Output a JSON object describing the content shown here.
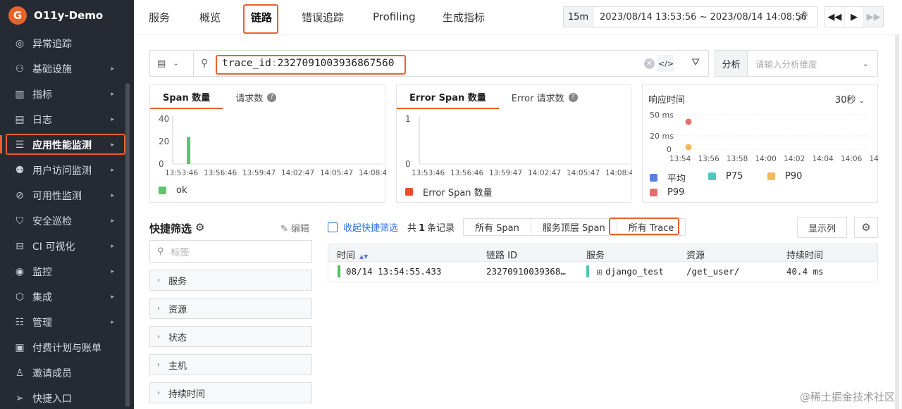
{
  "app": {
    "name": "O11y-Demo",
    "logo_letter": "G",
    "brand_color": "#e8622b"
  },
  "sidebar": {
    "items": [
      {
        "label": "异常追踪",
        "icon": "target-icon",
        "glyph": "◎",
        "arrow": false
      },
      {
        "label": "基础设施",
        "icon": "infrastructure-icon",
        "glyph": "⚇",
        "arrow": true
      },
      {
        "label": "指标",
        "icon": "metrics-icon",
        "glyph": "▥",
        "arrow": true
      },
      {
        "label": "日志",
        "icon": "log-icon",
        "glyph": "▤",
        "arrow": true
      },
      {
        "label": "应用性能监测",
        "icon": "apm-icon",
        "glyph": "☰",
        "arrow": true,
        "active": true
      },
      {
        "label": "用户访问监测",
        "icon": "rum-icon",
        "glyph": "⚉",
        "arrow": true
      },
      {
        "label": "可用性监测",
        "icon": "availability-icon",
        "glyph": "⊘",
        "arrow": true
      },
      {
        "label": "安全巡检",
        "icon": "shield-icon",
        "glyph": "⛉",
        "arrow": true
      },
      {
        "label": "CI 可视化",
        "icon": "ci-icon",
        "glyph": "⊟",
        "arrow": true
      },
      {
        "label": "监控",
        "icon": "monitor-icon",
        "glyph": "◉",
        "arrow": true
      },
      {
        "label": "集成",
        "icon": "integration-icon",
        "glyph": "⬡",
        "arrow": true
      },
      {
        "label": "管理",
        "icon": "settings-sliders-icon",
        "glyph": "☷",
        "arrow": true
      },
      {
        "label": "付费计划与账单",
        "icon": "billing-icon",
        "glyph": "▣",
        "arrow": false
      },
      {
        "label": "邀请成员",
        "icon": "user-icon",
        "glyph": "♙",
        "arrow": false
      },
      {
        "label": "快捷入口",
        "icon": "send-icon",
        "glyph": "➢",
        "arrow": false
      }
    ]
  },
  "topbar": {
    "tabs": [
      "服务",
      "概览",
      "链路",
      "错误追踪",
      "Profiling",
      "生成指标"
    ],
    "active_tab": "链路",
    "time_range_short": "15m",
    "time_range": "2023/08/14 13:53:56 ~ 2023/08/14 14:08:56"
  },
  "search": {
    "query_key": "trace_id",
    "query_sep": ":",
    "query_value": "2327091003936867560",
    "analyze_label": "分析",
    "analyze_placeholder": "请输入分析维度"
  },
  "charts": {
    "span_panel": {
      "tabs": [
        "Span 数量",
        "请求数"
      ],
      "legend": "ok",
      "legend_color": "#5cc46a"
    },
    "error_panel": {
      "tabs": [
        "Error Span 数量",
        "Error 请求数"
      ],
      "legend": "Error Span 数量",
      "legend_color": "#e0522b"
    },
    "rt_panel": {
      "title": "响应时间",
      "interval": "30秒",
      "legend": [
        {
          "name": "平均",
          "color": "#5b7fe6"
        },
        {
          "name": "P75",
          "color": "#4ec9c0"
        },
        {
          "name": "P90",
          "color": "#f5b85a"
        },
        {
          "name": "P99",
          "color": "#e86d6d"
        }
      ]
    }
  },
  "chart_data": [
    {
      "type": "bar",
      "x_ticks": [
        "13:53:46",
        "13:56:46",
        "13:59:47",
        "14:02:47",
        "14:05:47",
        "14:08:4"
      ],
      "y_ticks": [
        "0",
        "20",
        "40"
      ],
      "ylim": [
        0,
        40
      ],
      "series": [
        {
          "name": "ok",
          "color": "#5cc46a",
          "points": [
            {
              "x": "13:54:55",
              "y": 24
            }
          ]
        }
      ]
    },
    {
      "type": "bar",
      "x_ticks": [
        "13:53:46",
        "13:56:46",
        "13:59:47",
        "14:02:47",
        "14:05:47",
        "14:08:4"
      ],
      "y_ticks": [
        "0",
        "1"
      ],
      "ylim": [
        0,
        1
      ],
      "series": [
        {
          "name": "Error Span 数量",
          "color": "#e0522b",
          "points": []
        }
      ]
    },
    {
      "type": "scatter",
      "x_ticks": [
        "13:54",
        "13:56",
        "13:58",
        "14:00",
        "14:02",
        "14:04",
        "14:06",
        "14:08"
      ],
      "y_ticks": [
        "0",
        "20 ms",
        "50 ms"
      ],
      "series": [
        {
          "name": "P99",
          "color": "#e86d6d",
          "points": [
            {
              "x": "13:54",
              "y": 40.4
            }
          ]
        },
        {
          "name": "P90",
          "color": "#f5b85a",
          "points": [
            {
              "x": "13:54",
              "y": 0
            }
          ]
        }
      ]
    }
  ],
  "quick_filter": {
    "title": "快捷筛选",
    "edit_label": "编辑",
    "search_placeholder": "标签",
    "facets": [
      "服务",
      "资源",
      "状态",
      "主机",
      "持续时间"
    ]
  },
  "list": {
    "collapse_label": "收起快捷筛选",
    "count_prefix": "共",
    "count_value": "1",
    "count_suffix": "条记录",
    "segments": [
      "所有 Span",
      "服务顶层 Span",
      "所有 Trace"
    ],
    "active_segment": "所有 Trace",
    "show_columns_label": "显示列",
    "columns": [
      "时间",
      "链路 ID",
      "服务",
      "资源",
      "持续时间"
    ],
    "rows": [
      {
        "time": "08/14 13:54:55.433",
        "trace_id": "23270910039368…",
        "service": "django_test",
        "resource": "/get_user/",
        "duration": "40.4 ms"
      }
    ]
  },
  "watermark": "@稀土掘金技术社区"
}
